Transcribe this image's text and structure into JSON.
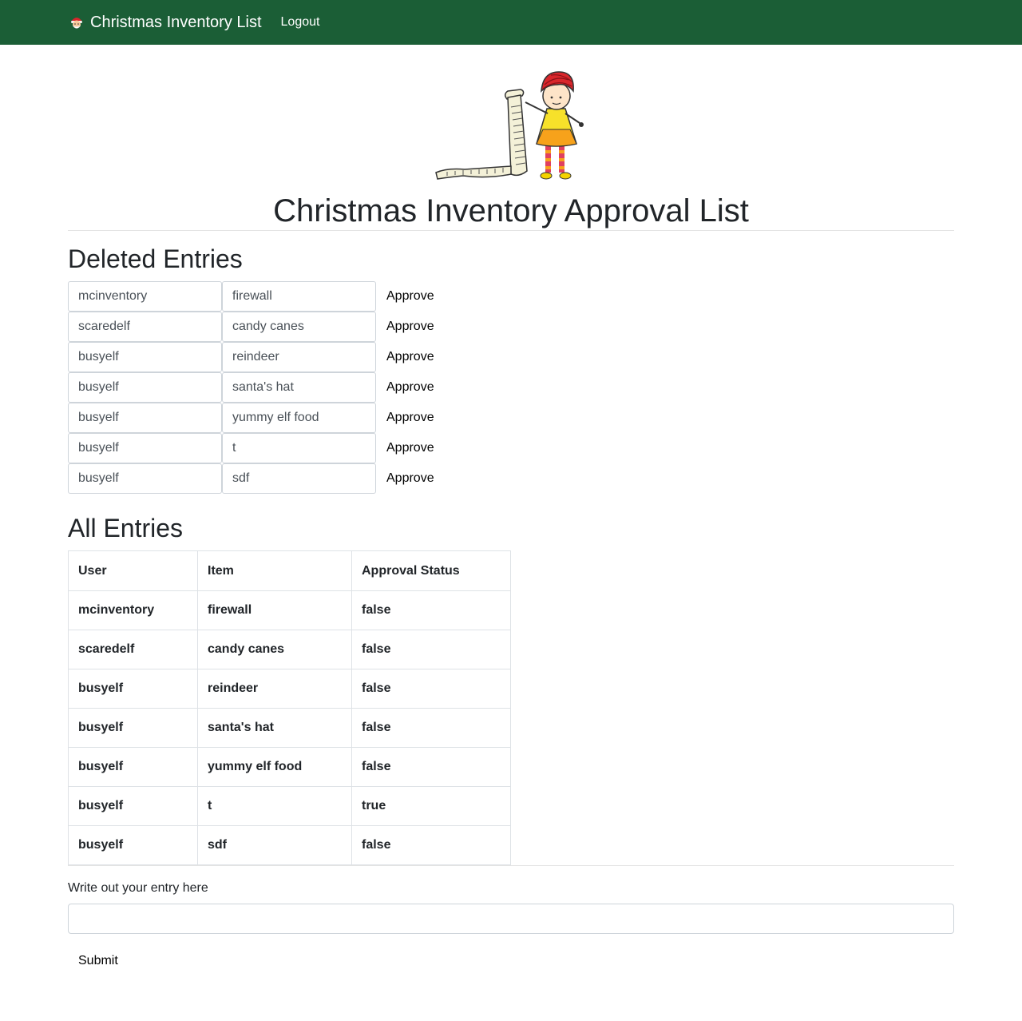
{
  "navbar": {
    "brand": "Christmas Inventory List",
    "brand_icon": "santa-face-icon",
    "logout": "Logout",
    "background": "#1b5e36"
  },
  "header": {
    "illustration": "elf-with-list-illustration",
    "title": "Christmas Inventory Approval List"
  },
  "deleted": {
    "heading": "Deleted Entries",
    "approve_label": "Approve",
    "rows": [
      {
        "user": "mcinventory",
        "item": "firewall"
      },
      {
        "user": "scaredelf",
        "item": "candy canes"
      },
      {
        "user": "busyelf",
        "item": "reindeer"
      },
      {
        "user": "busyelf",
        "item": "santa's hat"
      },
      {
        "user": "busyelf",
        "item": "yummy elf food"
      },
      {
        "user": "busyelf",
        "item": "t"
      },
      {
        "user": "busyelf",
        "item": "sdf"
      }
    ]
  },
  "all": {
    "heading": "All Entries",
    "columns": [
      "User",
      "Item",
      "Approval Status"
    ],
    "rows": [
      {
        "user": "mcinventory",
        "item": "firewall",
        "status": "false"
      },
      {
        "user": "scaredelf",
        "item": "candy canes",
        "status": "false"
      },
      {
        "user": "busyelf",
        "item": "reindeer",
        "status": "false"
      },
      {
        "user": "busyelf",
        "item": "santa's hat",
        "status": "false"
      },
      {
        "user": "busyelf",
        "item": "yummy elf food",
        "status": "false"
      },
      {
        "user": "busyelf",
        "item": "t",
        "status": "true"
      },
      {
        "user": "busyelf",
        "item": "sdf",
        "status": "false"
      }
    ]
  },
  "form": {
    "label": "Write out your entry here",
    "value": "",
    "submit": "Submit"
  }
}
